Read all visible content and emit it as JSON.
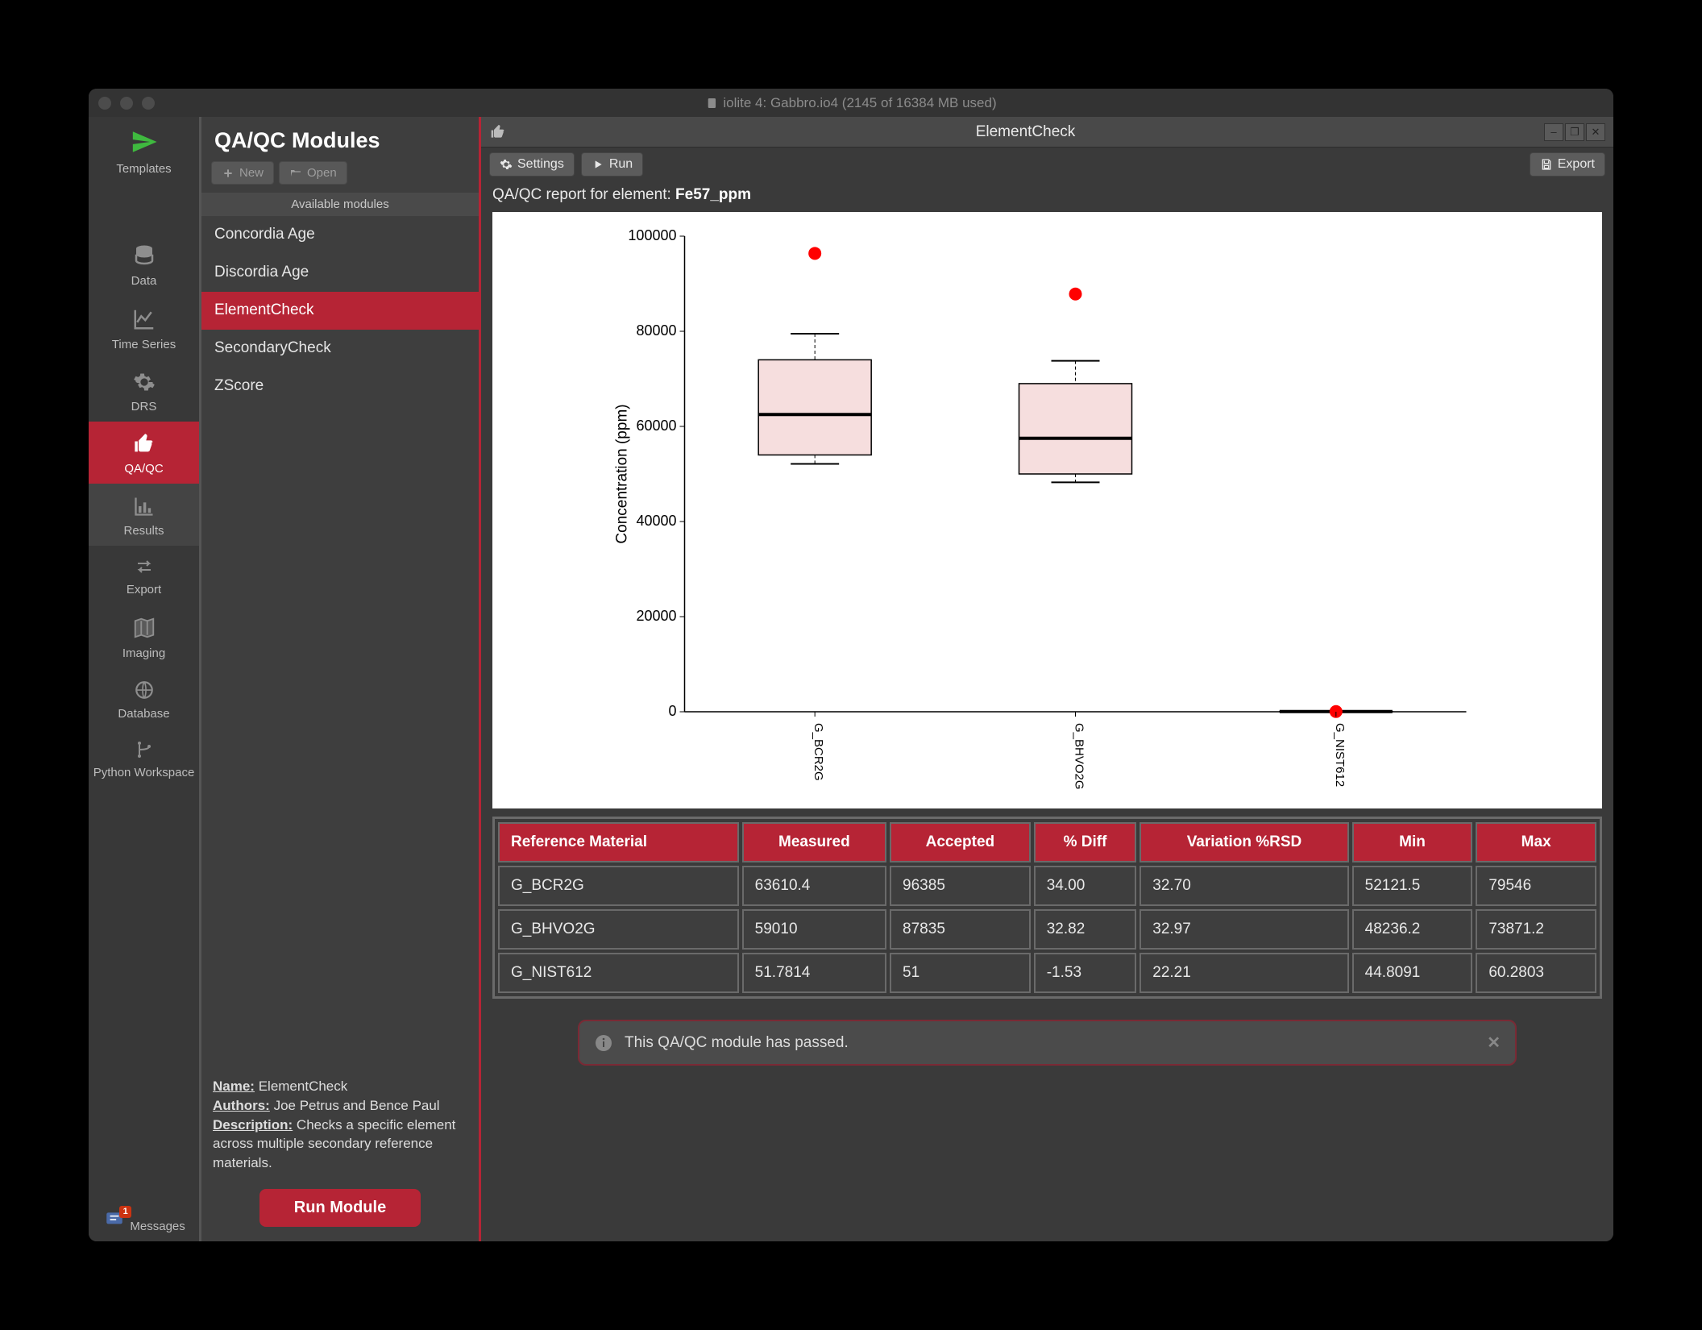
{
  "window": {
    "title": "iolite 4: Gabbro.io4 (2145 of 16384 MB used)"
  },
  "leftnav": {
    "items": [
      {
        "label": "Templates"
      },
      {
        "label": "Data"
      },
      {
        "label": "Time Series"
      },
      {
        "label": "DRS"
      },
      {
        "label": "QA/QC"
      },
      {
        "label": "Results"
      },
      {
        "label": "Export"
      },
      {
        "label": "Imaging"
      },
      {
        "label": "Database"
      },
      {
        "label": "Python Workspace"
      }
    ],
    "messages_label": "Messages",
    "messages_badge": "1"
  },
  "modules": {
    "heading": "QA/QC Modules",
    "new_label": "New",
    "open_label": "Open",
    "available_label": "Available modules",
    "items": [
      "Concordia Age",
      "Discordia Age",
      "ElementCheck",
      "SecondaryCheck",
      "ZScore"
    ],
    "selected": "ElementCheck",
    "info_name_label": "Name:",
    "info_name": "ElementCheck",
    "info_authors_label": "Authors:",
    "info_authors": "Joe Petrus and Bence Paul",
    "info_desc_label": "Description:",
    "info_desc": "Checks a specific element across multiple secondary reference materials.",
    "run_label": "Run Module"
  },
  "main": {
    "pane_title": "ElementCheck",
    "settings_label": "Settings",
    "run_label": "Run",
    "export_label": "Export",
    "report_prefix": "QA/QC report for element:",
    "report_element": "Fe57_ppm"
  },
  "chart_data": {
    "type": "boxplot",
    "title": "",
    "ylabel": "Concentration (ppm)",
    "xlabel": "",
    "ylim": [
      0,
      100000
    ],
    "yticks": [
      0,
      20000,
      40000,
      60000,
      80000,
      100000
    ],
    "categories": [
      "G_BCR2G",
      "G_BHVO2G",
      "G_NIST612"
    ],
    "series": [
      {
        "name": "G_BCR2G",
        "min": 52122,
        "q1": 54000,
        "median": 62500,
        "q3": 74000,
        "max": 79500,
        "outlier": 96385
      },
      {
        "name": "G_BHVO2G",
        "min": 48236,
        "q1": 50000,
        "median": 57500,
        "q3": 69000,
        "max": 73800,
        "outlier": 87835
      },
      {
        "name": "G_NIST612",
        "min": 45,
        "q1": 48,
        "median": 51,
        "q3": 55,
        "max": 60,
        "outlier": 40
      }
    ]
  },
  "table": {
    "headers": [
      "Reference Material",
      "Measured",
      "Accepted",
      "% Diff",
      "Variation %RSD",
      "Min",
      "Max"
    ],
    "rows": [
      [
        "G_BCR2G",
        "63610.4",
        "96385",
        "34.00",
        "32.70",
        "52121.5",
        "79546"
      ],
      [
        "G_BHVO2G",
        "59010",
        "87835",
        "32.82",
        "32.97",
        "48236.2",
        "73871.2"
      ],
      [
        "G_NIST612",
        "51.7814",
        "51",
        "-1.53",
        "22.21",
        "44.8091",
        "60.2803"
      ]
    ]
  },
  "toast": {
    "text": "This QA/QC module has passed."
  }
}
